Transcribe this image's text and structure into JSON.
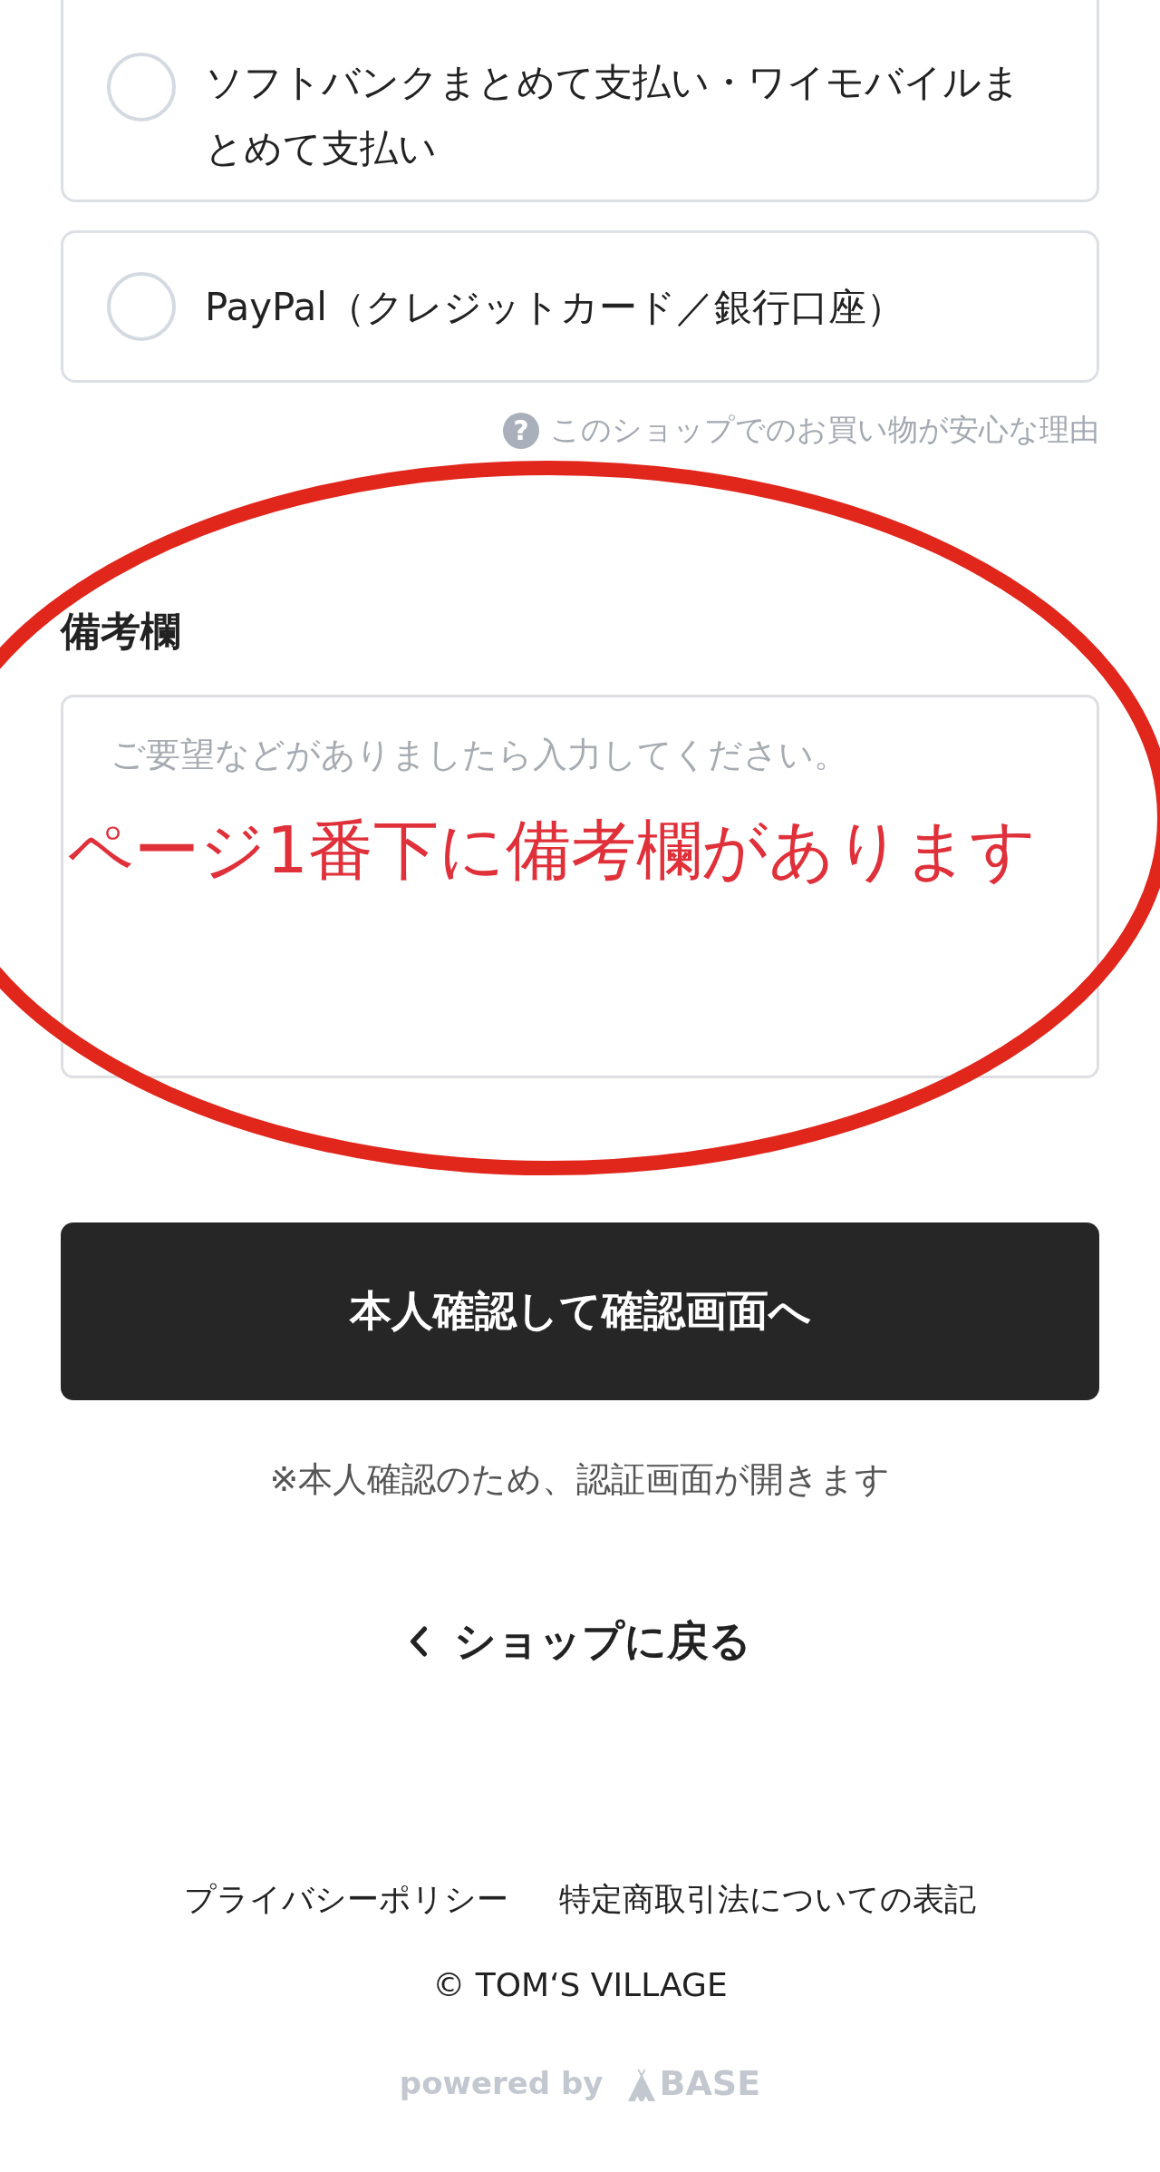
{
  "payment_options": [
    {
      "label": "ソフトバンクまとめて支払い・ワイモバイルまとめて支払い",
      "selected": false
    },
    {
      "label": "PayPal（クレジットカード／銀行口座）",
      "selected": false
    }
  ],
  "help_link": {
    "icon": "?",
    "text": "このショップでのお買い物が安心な理由"
  },
  "notes": {
    "label": "備考欄",
    "placeholder": "ご要望などがありましたら入力してください。"
  },
  "annotation": {
    "text": "ページ1番下に備考欄があります"
  },
  "submit_button": "本人確認して確認画面へ",
  "submit_note": "※本人確認のため、認証画面が開きます",
  "back_link": "ショップに戻る",
  "footer_links": [
    "プライバシーポリシー",
    "特定商取引法についての表記"
  ],
  "copyright": "© TOM‘S VILLAGE",
  "powered_by": {
    "text": "powered by",
    "brand": "BASE"
  }
}
